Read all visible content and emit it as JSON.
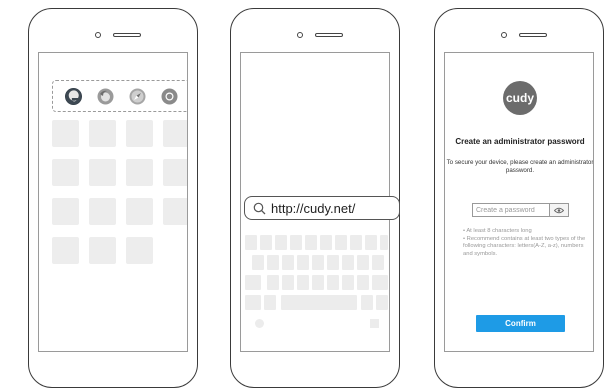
{
  "phone1": {
    "browsers": [
      {
        "icon": "edge-icon"
      },
      {
        "icon": "firefox-icon"
      },
      {
        "icon": "safari-icon"
      },
      {
        "icon": "chrome-icon"
      }
    ]
  },
  "phone2": {
    "url_bar": {
      "text": "http://cudy.net/",
      "icon": "search-icon"
    }
  },
  "phone3": {
    "logo": "cudy",
    "title": "Create an administrator password",
    "subtitle": "To secure your device, please create an administrator password.",
    "password_field": {
      "placeholder": "Create a password",
      "toggle_icon": "eye-icon"
    },
    "hints": [
      "• At least 8 characters long",
      "• Recommend contains at least two types of the following characters: letters(A-Z, a-z), numbers and symbols."
    ],
    "confirm_label": "Confirm",
    "accent_color": "#1e9be6"
  }
}
